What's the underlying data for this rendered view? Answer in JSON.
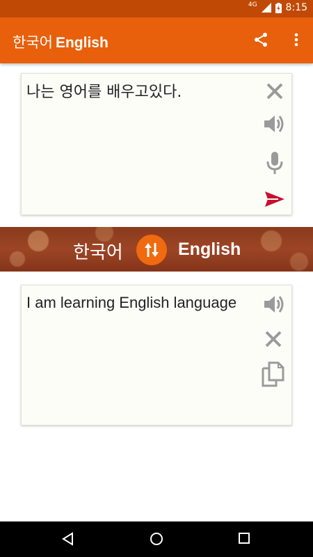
{
  "status_bar": {
    "network": "4G",
    "time": "8:15"
  },
  "app_bar": {
    "title_source": "한국어",
    "title_target": "English",
    "actions": [
      "share-icon",
      "more-vert-icon"
    ]
  },
  "input_card": {
    "text": "나는 영어를 배우고있다.",
    "actions": [
      "clear-icon",
      "speaker-icon",
      "mic-icon",
      "send-icon"
    ]
  },
  "language_bar": {
    "source": "한국어",
    "target": "English",
    "swap_icon": "swap-vertical-icon"
  },
  "output_card": {
    "text": "I am learning English language",
    "actions": [
      "speaker-icon",
      "clear-icon",
      "copy-icon"
    ]
  },
  "nav_bar": {
    "buttons": [
      "back-icon",
      "home-icon",
      "recents-icon"
    ]
  },
  "colors": {
    "status_bar": "#c04a05",
    "app_bar": "#e8600b",
    "send": "#c8102e",
    "icon_gray": "#9a9a9a",
    "swap_button": "#f06a0f",
    "language_bar": "#93401f"
  }
}
